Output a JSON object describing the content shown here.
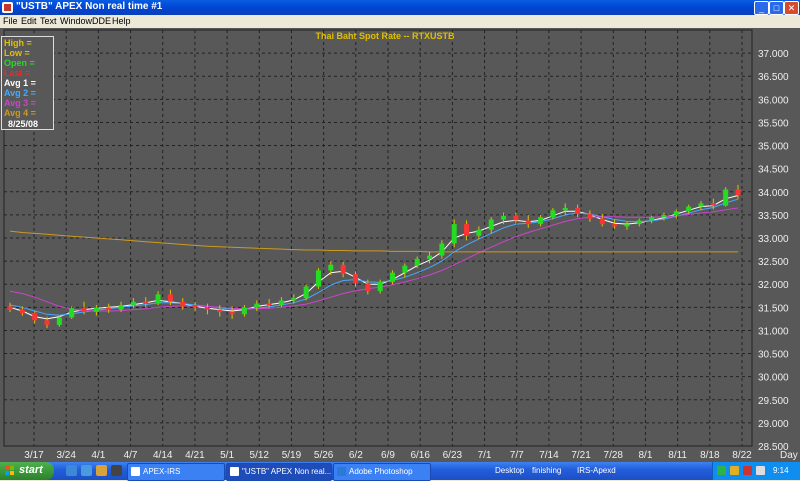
{
  "window": {
    "title": "\"USTB\" APEX Non real time #1"
  },
  "menu": [
    "File",
    "Edit",
    "Text",
    "Window",
    "DDE",
    "Help"
  ],
  "chart_header": {
    "title": "Thai Baht Spot Rate -- RTXUSTB"
  },
  "legend": {
    "rows": [
      {
        "label": "High",
        "value": "=",
        "color": "#e0c000"
      },
      {
        "label": "Low",
        "value": "=",
        "color": "#e0c000"
      },
      {
        "label": "Open",
        "value": "=",
        "color": "#22dd22"
      },
      {
        "label": "Last",
        "value": "=",
        "color": "#ff2222"
      },
      {
        "label": "Avg 1",
        "value": "=",
        "color": "#ffffff"
      },
      {
        "label": "Avg 2",
        "value": "=",
        "color": "#44aaff"
      },
      {
        "label": "Avg 3",
        "value": "=",
        "color": "#cc44cc"
      },
      {
        "label": "Avg 4",
        "value": "=",
        "color": "#cc9922"
      }
    ],
    "date": "8/25/08"
  },
  "chart_data": {
    "type": "candlestick",
    "title": "Thai Baht Spot Rate -- RTXUSTB",
    "ylim": [
      28.5,
      37.5
    ],
    "y_ticks": [
      "37.000",
      "36.500",
      "36.000",
      "35.500",
      "35.000",
      "34.500",
      "34.000",
      "33.500",
      "33.000",
      "32.500",
      "32.000",
      "31.500",
      "31.000",
      "30.500",
      "30.000",
      "29.500",
      "29.000",
      "28.500"
    ],
    "x_ticks": [
      "3/17",
      "3/24",
      "4/1",
      "4/7",
      "4/14",
      "4/21",
      "5/1",
      "5/12",
      "5/19",
      "5/26",
      "6/2",
      "6/9",
      "6/16",
      "6/23",
      "7/1",
      "7/7",
      "7/14",
      "7/21",
      "7/28",
      "8/1",
      "8/11",
      "8/18",
      "8/22"
    ],
    "x_axis_label": "Day",
    "candles": [
      [
        31.52,
        31.6,
        31.4,
        31.45
      ],
      [
        31.45,
        31.52,
        31.32,
        31.38
      ],
      [
        31.38,
        31.42,
        31.15,
        31.22
      ],
      [
        31.22,
        31.3,
        31.05,
        31.12
      ],
      [
        31.12,
        31.32,
        31.08,
        31.28
      ],
      [
        31.28,
        31.52,
        31.25,
        31.48
      ],
      [
        31.48,
        31.62,
        31.35,
        31.4
      ],
      [
        31.4,
        31.55,
        31.32,
        31.5
      ],
      [
        31.5,
        31.58,
        31.38,
        31.45
      ],
      [
        31.45,
        31.62,
        31.4,
        31.55
      ],
      [
        31.55,
        31.7,
        31.48,
        31.62
      ],
      [
        31.62,
        31.72,
        31.5,
        31.58
      ],
      [
        31.58,
        31.85,
        31.55,
        31.78
      ],
      [
        31.78,
        31.88,
        31.55,
        31.62
      ],
      [
        31.62,
        31.7,
        31.45,
        31.52
      ],
      [
        31.55,
        31.62,
        31.42,
        31.5
      ],
      [
        31.5,
        31.58,
        31.35,
        31.45
      ],
      [
        31.45,
        31.55,
        31.3,
        31.4
      ],
      [
        31.4,
        31.52,
        31.25,
        31.35
      ],
      [
        31.35,
        31.55,
        31.3,
        31.5
      ],
      [
        31.5,
        31.65,
        31.42,
        31.58
      ],
      [
        31.58,
        31.68,
        31.48,
        31.55
      ],
      [
        31.55,
        31.72,
        31.5,
        31.65
      ],
      [
        31.65,
        31.78,
        31.58,
        31.7
      ],
      [
        31.7,
        32.0,
        31.65,
        31.95
      ],
      [
        31.95,
        32.35,
        31.9,
        32.3
      ],
      [
        32.3,
        32.5,
        32.2,
        32.42
      ],
      [
        32.42,
        32.48,
        32.15,
        32.22
      ],
      [
        32.22,
        32.28,
        31.95,
        32.02
      ],
      [
        32.02,
        32.1,
        31.78,
        31.85
      ],
      [
        31.85,
        32.1,
        31.8,
        32.05
      ],
      [
        32.05,
        32.3,
        32.0,
        32.25
      ],
      [
        32.25,
        32.45,
        32.15,
        32.4
      ],
      [
        32.4,
        32.6,
        32.35,
        32.55
      ],
      [
        32.55,
        32.7,
        32.45,
        32.62
      ],
      [
        32.62,
        32.95,
        32.55,
        32.88
      ],
      [
        32.88,
        33.4,
        32.8,
        33.3
      ],
      [
        33.3,
        33.38,
        32.95,
        33.05
      ],
      [
        33.05,
        33.25,
        32.98,
        33.18
      ],
      [
        33.18,
        33.45,
        33.1,
        33.4
      ],
      [
        33.4,
        33.55,
        33.3,
        33.48
      ],
      [
        33.48,
        33.55,
        33.32,
        33.38
      ],
      [
        33.38,
        33.5,
        33.22,
        33.3
      ],
      [
        33.3,
        33.5,
        33.25,
        33.45
      ],
      [
        33.45,
        33.65,
        33.4,
        33.6
      ],
      [
        33.6,
        33.75,
        33.5,
        33.65
      ],
      [
        33.65,
        33.72,
        33.45,
        33.52
      ],
      [
        33.52,
        33.6,
        33.35,
        33.42
      ],
      [
        33.42,
        33.52,
        33.25,
        33.3
      ],
      [
        33.3,
        33.4,
        33.2,
        33.25
      ],
      [
        33.25,
        33.35,
        33.18,
        33.3
      ],
      [
        33.3,
        33.42,
        33.25,
        33.38
      ],
      [
        33.38,
        33.48,
        33.32,
        33.45
      ],
      [
        33.45,
        33.55,
        33.38,
        33.5
      ],
      [
        33.5,
        33.62,
        33.42,
        33.58
      ],
      [
        33.58,
        33.72,
        33.52,
        33.68
      ],
      [
        33.68,
        33.8,
        33.6,
        33.75
      ],
      [
        33.75,
        33.85,
        33.62,
        33.7
      ],
      [
        33.7,
        34.1,
        33.68,
        34.05
      ],
      [
        34.05,
        34.15,
        33.85,
        33.92
      ]
    ],
    "series": [
      {
        "name": "Avg 1",
        "color": "#ffffff",
        "values": [
          31.5,
          31.42,
          31.3,
          31.25,
          31.3,
          31.4,
          31.45,
          31.48,
          31.5,
          31.52,
          31.56,
          31.6,
          31.65,
          31.62,
          31.58,
          31.52,
          31.48,
          31.45,
          31.42,
          31.45,
          31.52,
          31.56,
          31.6,
          31.66,
          31.8,
          32.05,
          32.25,
          32.28,
          32.15,
          32.0,
          32.0,
          32.1,
          32.25,
          32.4,
          32.52,
          32.7,
          33.0,
          33.1,
          33.15,
          33.25,
          33.35,
          33.38,
          33.35,
          33.38,
          33.48,
          33.58,
          33.58,
          33.5,
          33.4,
          33.32,
          33.3,
          33.33,
          33.38,
          33.44,
          33.52,
          33.6,
          33.68,
          33.7,
          33.85,
          33.92
        ]
      },
      {
        "name": "Avg 2",
        "color": "#44aaff",
        "values": [
          31.55,
          31.5,
          31.42,
          31.35,
          31.33,
          31.36,
          31.4,
          31.44,
          31.47,
          31.5,
          31.53,
          31.56,
          31.6,
          31.6,
          31.58,
          31.55,
          31.52,
          31.49,
          31.46,
          31.46,
          31.48,
          31.51,
          31.55,
          31.6,
          31.68,
          31.82,
          31.98,
          32.08,
          32.1,
          32.05,
          32.04,
          32.08,
          32.15,
          32.25,
          32.36,
          32.5,
          32.7,
          32.85,
          32.98,
          33.1,
          33.22,
          33.3,
          33.32,
          33.35,
          33.42,
          33.5,
          33.54,
          33.52,
          33.46,
          33.4,
          33.36,
          33.35,
          33.37,
          33.41,
          33.47,
          33.54,
          33.61,
          33.66,
          33.76,
          33.84
        ]
      },
      {
        "name": "Avg 3",
        "color": "#cc44cc",
        "values": [
          31.85,
          31.8,
          31.72,
          31.62,
          31.52,
          31.46,
          31.43,
          31.42,
          31.42,
          31.43,
          31.45,
          31.47,
          31.5,
          31.52,
          31.53,
          31.53,
          31.52,
          31.5,
          31.48,
          31.47,
          31.47,
          31.48,
          31.5,
          31.53,
          31.57,
          31.64,
          31.72,
          31.8,
          31.86,
          31.9,
          31.94,
          31.99,
          32.05,
          32.12,
          32.2,
          32.3,
          32.42,
          32.55,
          32.68,
          32.8,
          32.92,
          33.03,
          33.12,
          33.2,
          33.28,
          33.36,
          33.42,
          33.45,
          33.46,
          33.46,
          33.45,
          33.45,
          33.45,
          33.46,
          33.48,
          33.51,
          33.54,
          33.57,
          33.61,
          33.65
        ]
      },
      {
        "name": "Avg 4",
        "color": "#cc9922",
        "values": [
          33.15,
          33.12,
          33.1,
          33.08,
          33.06,
          33.04,
          33.02,
          33.0,
          32.98,
          32.96,
          32.94,
          32.92,
          32.9,
          32.88,
          32.86,
          32.84,
          32.82,
          32.81,
          32.8,
          32.79,
          32.78,
          32.77,
          32.76,
          32.75,
          32.74,
          32.74,
          32.73,
          32.73,
          32.72,
          32.72,
          32.72,
          32.71,
          32.71,
          32.71,
          32.7,
          32.7,
          32.7,
          32.7,
          32.7,
          32.7,
          32.7,
          32.7,
          32.7,
          32.7,
          32.7,
          32.7,
          32.7,
          32.7,
          32.7,
          32.7,
          32.7,
          32.7,
          32.7,
          32.7,
          32.7,
          32.7,
          32.7,
          32.7,
          32.7,
          32.7
        ]
      }
    ]
  },
  "taskbar": {
    "start": "start",
    "tasks": [
      {
        "label": "APEX-IRS"
      },
      {
        "label": "\"USTB\" APEX Non real..."
      },
      {
        "label": "Adobe Photoshop"
      }
    ],
    "toolbars": [
      "Desktop",
      "finishing",
      "IRS-Apexd"
    ],
    "clock": "9:14"
  }
}
